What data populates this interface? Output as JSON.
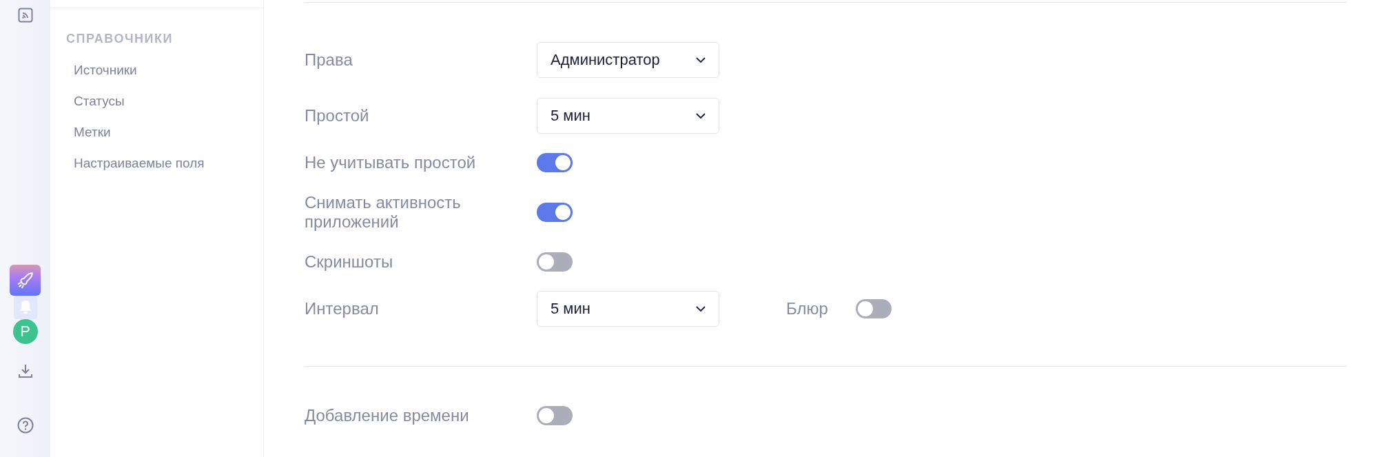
{
  "rail": {
    "avatar": "P"
  },
  "sidebar": {
    "heading": "СПРАВОЧНИКИ",
    "items": [
      {
        "label": "Источники"
      },
      {
        "label": "Статусы"
      },
      {
        "label": "Метки"
      },
      {
        "label": "Настраиваемые поля"
      }
    ]
  },
  "settings": [
    {
      "kind": "select",
      "label": "Права",
      "value": "Администратор"
    },
    {
      "kind": "select",
      "label": "Простой",
      "value": "5 мин"
    },
    {
      "kind": "toggle",
      "label": "Не учитывать простой",
      "on": true
    },
    {
      "kind": "toggle",
      "label": "Снимать активность приложений",
      "on": true
    },
    {
      "kind": "toggle",
      "label": "Скриншоты",
      "on": false
    },
    {
      "kind": "select",
      "label": "Интервал",
      "value": "5 мин",
      "extra": {
        "label": "Блюр",
        "on": false
      }
    }
  ],
  "settings_2": [
    {
      "kind": "toggle",
      "label": "Добавление времени",
      "on": false
    }
  ]
}
